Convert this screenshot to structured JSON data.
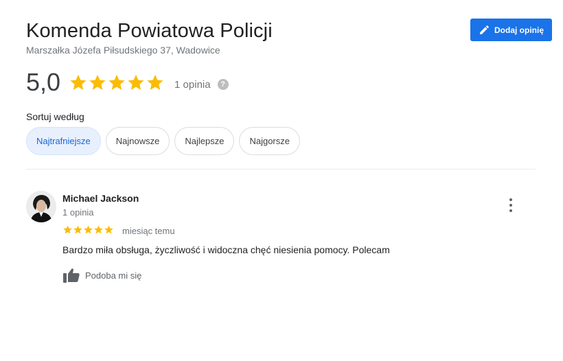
{
  "place": {
    "name": "Komenda Powiatowa Policji",
    "address": "Marszałka Józefa Piłsudskiego 37, Wadowice"
  },
  "add_review_button": {
    "label": "Dodaj opinię",
    "icon": "pencil-icon",
    "color": "#1a73e8"
  },
  "summary": {
    "rating": "5,0",
    "stars": 5,
    "count_label": "1 opinia",
    "help_icon": "question-circle-icon",
    "star_color": "#fbbc04"
  },
  "sort": {
    "label": "Sortuj według",
    "options": [
      "Najtrafniejsze",
      "Najnowsze",
      "Najlepsze",
      "Najgorsze"
    ],
    "selected": "Najtrafniejsze"
  },
  "reviews": [
    {
      "author": "Michael Jackson",
      "author_reviews": "1 opinia",
      "stars": 5,
      "time": "miesiąc temu",
      "text": "Bardzo miła obsługa, życzliwość i widoczna chęć niesienia pomocy. Polecam",
      "like_label": "Podoba mi się",
      "like_icon": "thumbs-up-icon",
      "menu_icon": "more-vertical-icon"
    }
  ]
}
